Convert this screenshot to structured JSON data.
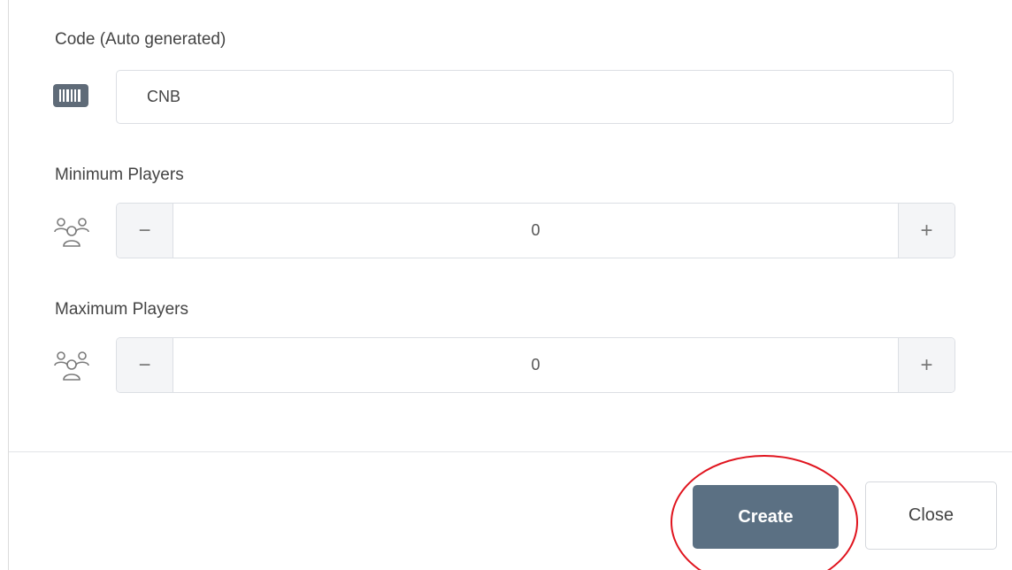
{
  "form": {
    "code": {
      "label": "Code (Auto generated)",
      "value": "CNB",
      "icon": "barcode-icon"
    },
    "min_players": {
      "label": "Minimum Players",
      "value": "0",
      "decrement": "−",
      "increment": "+",
      "icon": "users-icon"
    },
    "max_players": {
      "label": "Maximum Players",
      "value": "0",
      "decrement": "−",
      "increment": "+",
      "icon": "users-icon"
    }
  },
  "footer": {
    "create_label": "Create",
    "close_label": "Close"
  },
  "colors": {
    "primary": "#5b7083",
    "annotation": "#e0141e"
  }
}
